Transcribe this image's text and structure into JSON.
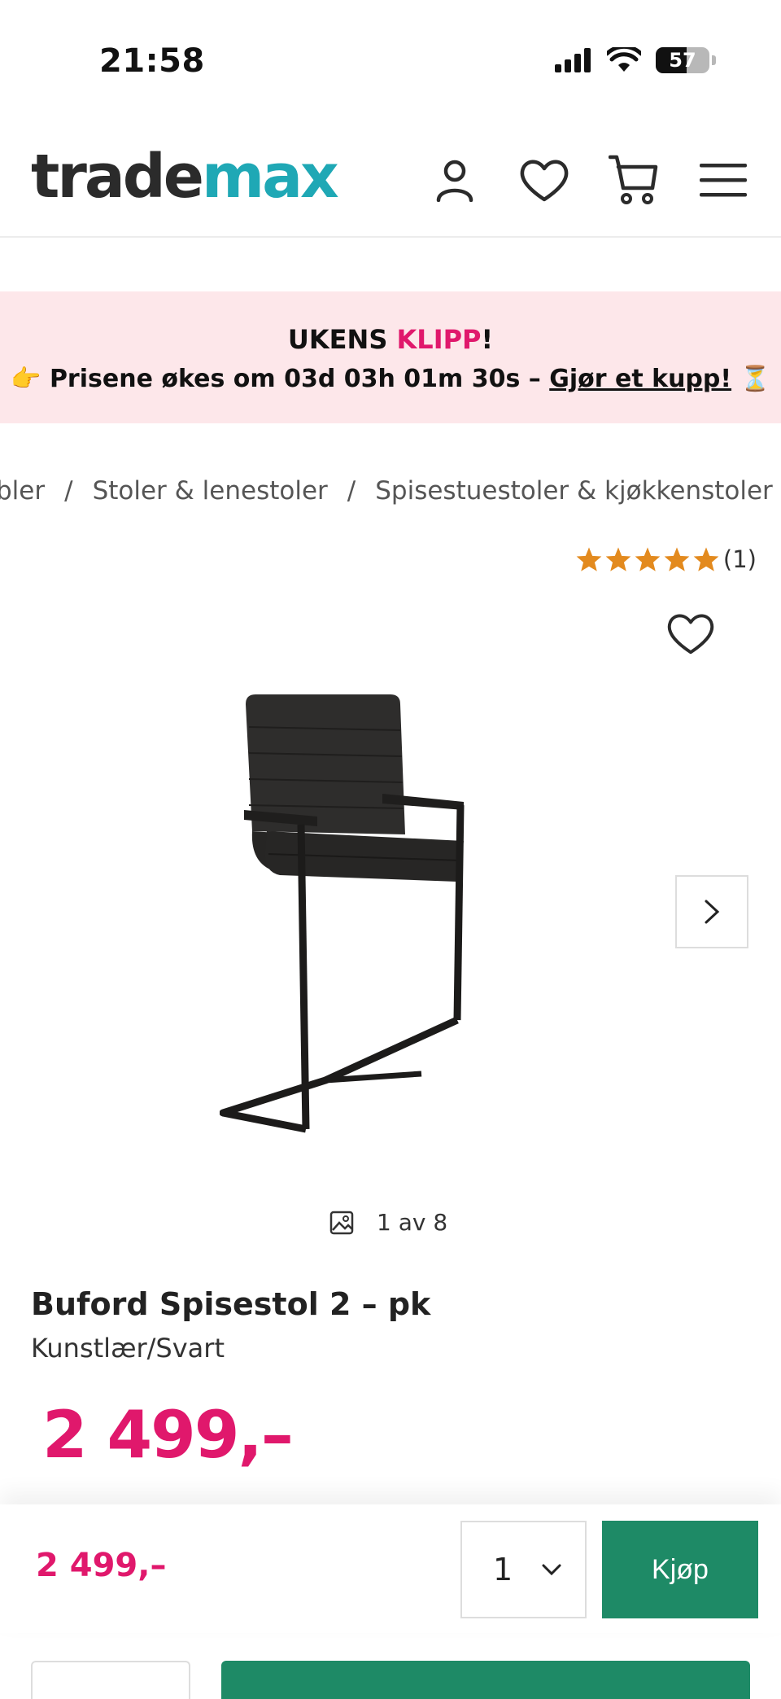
{
  "status_bar": {
    "time": "21:58",
    "battery_percent": "57",
    "battery_level": 0.57,
    "icons": [
      "signal-icon",
      "wifi-icon",
      "battery-icon"
    ]
  },
  "header": {
    "logo_part1": "trade",
    "logo_part2": "max",
    "icons": [
      "account-icon",
      "wishlist-heart-icon",
      "cart-icon",
      "menu-icon"
    ],
    "colors": {
      "logo_dark": "#2b2b2b",
      "logo_accent": "#1fa8b5"
    }
  },
  "promo": {
    "title_prefix": "UKENS ",
    "title_accent": "KLIPP",
    "title_suffix": "!",
    "emoji_start": "👉",
    "message": "Prisene økes om 03d 03h 01m 30s – ",
    "link": "Gjør et kupp!",
    "emoji_end": "⏳",
    "background": "#fde7ea"
  },
  "breadcrumb": {
    "items": [
      "bler",
      "Stoler & lenestoler",
      "Spisestuestoler & kjøkkenstoler"
    ],
    "separator": "/"
  },
  "rating": {
    "stars": 5,
    "count_label": "(1)"
  },
  "gallery": {
    "counter": "1 av 8"
  },
  "product": {
    "title": "Buford Spisestol 2 – pk",
    "variant": "Kunstlær/Svart",
    "price": "2 499,–"
  },
  "buybar": {
    "price": "2 499,–",
    "quantity": "1",
    "buy_label": "Kjøp"
  },
  "colors": {
    "price": "#e0186c",
    "buy_button": "#1e8a66",
    "star": "#e38a1e"
  }
}
